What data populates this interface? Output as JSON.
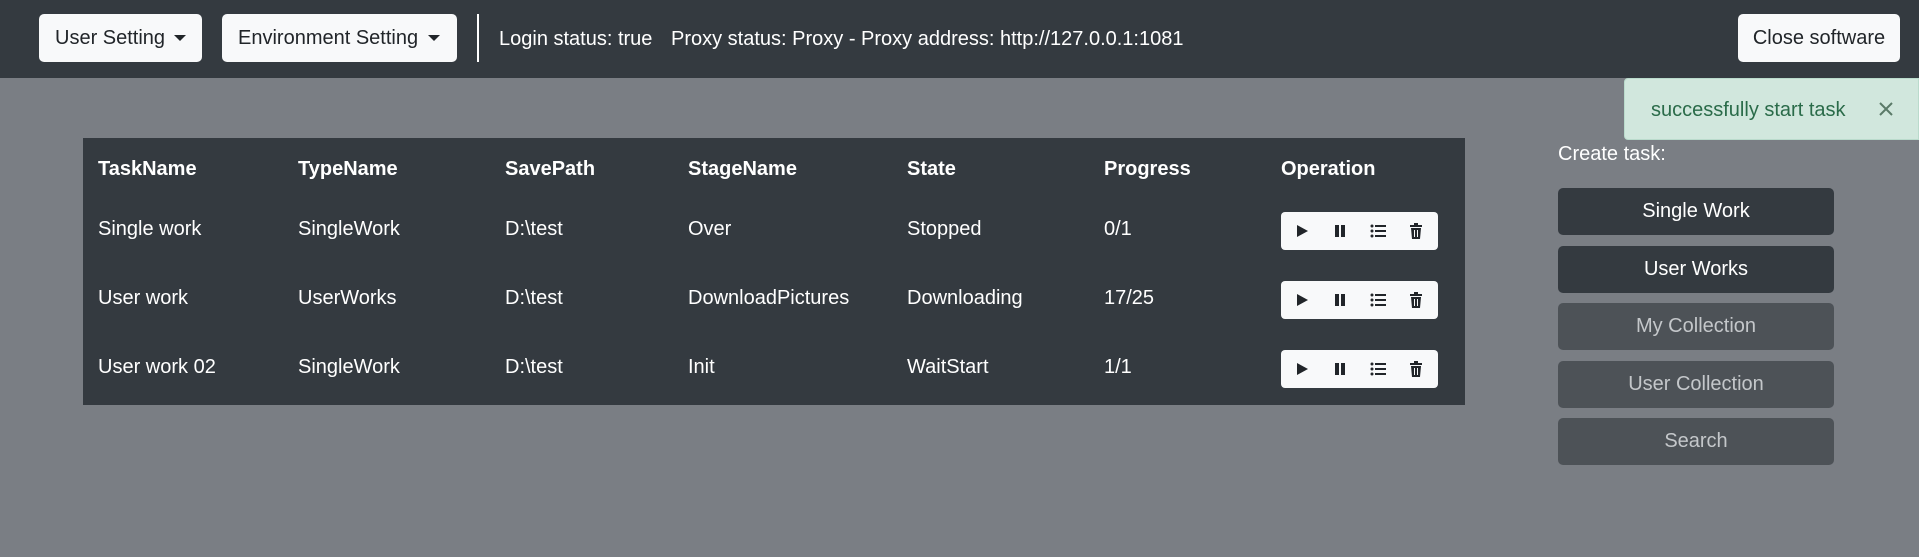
{
  "header": {
    "user_setting_label": "User Setting",
    "environment_setting_label": "Environment Setting",
    "login_status": "Login status: true",
    "proxy_status": "Proxy status: Proxy - Proxy address: http://127.0.0.1:1081",
    "close_label": "Close software"
  },
  "table": {
    "headers": [
      "TaskName",
      "TypeName",
      "SavePath",
      "StageName",
      "State",
      "Progress",
      "Operation"
    ],
    "rows": [
      [
        "Single work",
        "SingleWork",
        "D:\\test",
        "Over",
        "Stopped",
        "0/1"
      ],
      [
        "User work",
        "UserWorks",
        "D:\\test",
        "DownloadPictures",
        "Downloading",
        "17/25"
      ],
      [
        "User work 02",
        "SingleWork",
        "D:\\test",
        "Init",
        "WaitStart",
        "1/1"
      ]
    ],
    "operation_icons": [
      "play-icon",
      "pause-icon",
      "list-icon",
      "trash-icon"
    ]
  },
  "create": {
    "label": "Create task:",
    "buttons": [
      "Single Work",
      "User Works",
      "My Collection",
      "User Collection",
      "Search"
    ]
  },
  "toast": {
    "message": "successfully start task",
    "close_symbol": "×"
  },
  "colors": {
    "topbar": "#343a40",
    "background": "#7a7e84",
    "toast_bg": "#d1e7dd",
    "toast_text": "#2a6b49"
  }
}
